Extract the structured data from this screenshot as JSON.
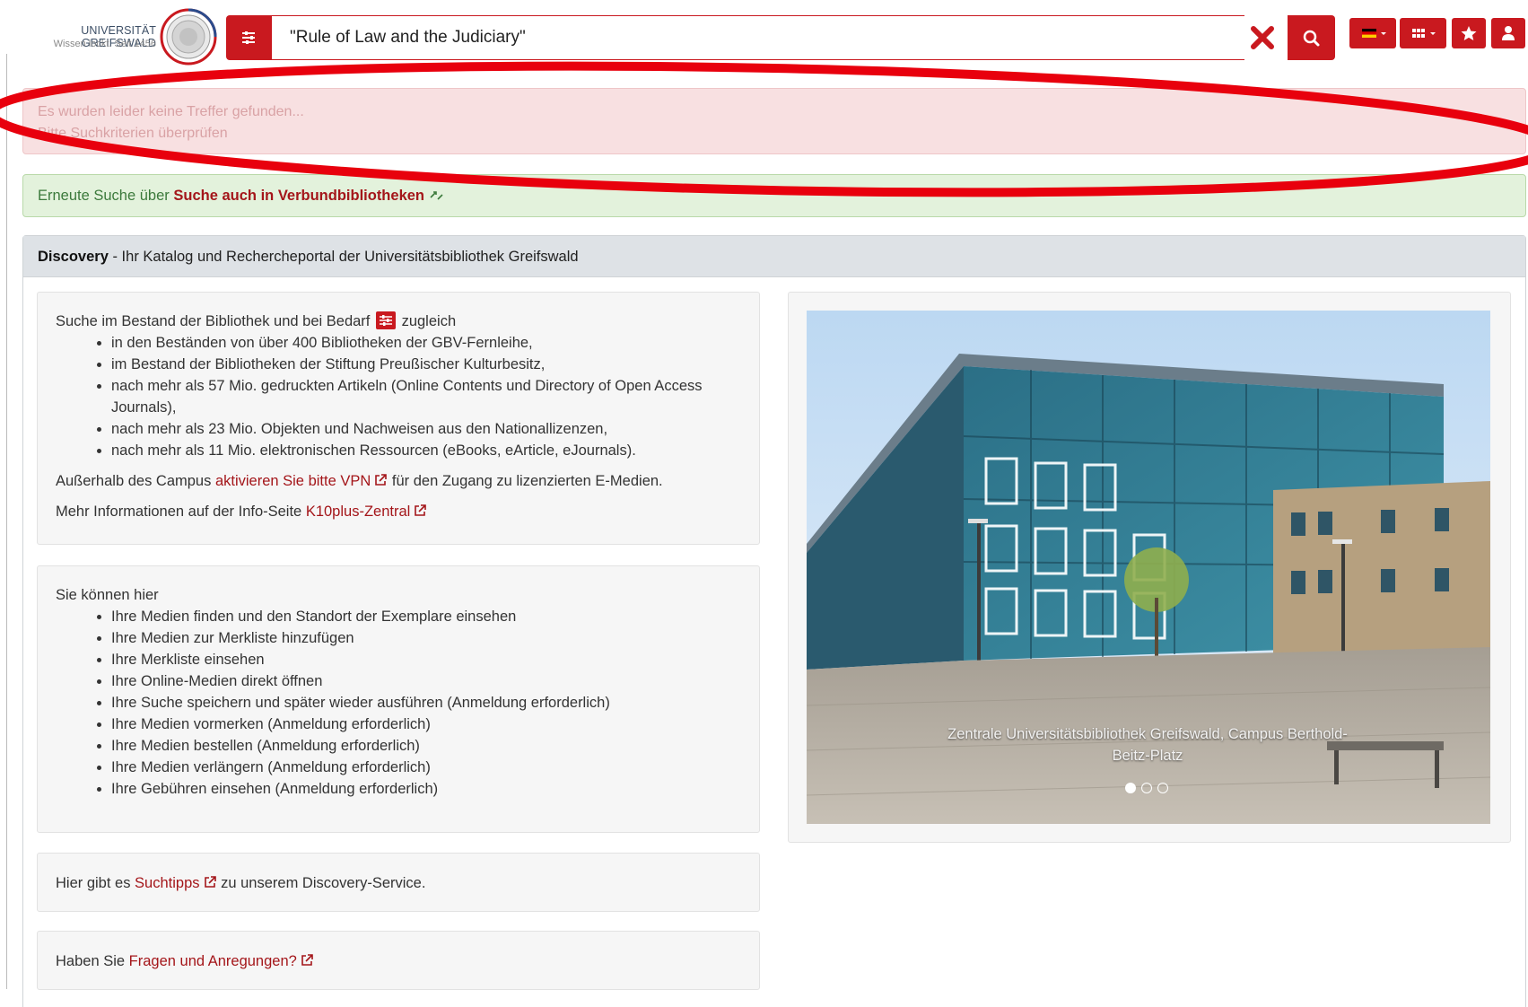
{
  "header": {
    "logo_name": "UNIVERSITÄT GREIFSWALD",
    "logo_tagline": "Wissen lockt. Seit 1456",
    "search_value": "\"Rule of Law and the Judiciary\"",
    "icons": [
      "sliders-icon",
      "clear-x-icon",
      "search-icon",
      "flag-de-icon",
      "grid-icon",
      "star-icon",
      "user-icon"
    ]
  },
  "alerts": {
    "no_results_line1": "Es wurden leider keine Treffer gefunden...",
    "no_results_line2": "Bitte Suchkriterien überprüfen",
    "retry_prefix": "Erneute Suche über",
    "retry_link": "Suche auch in Verbundbibliotheken"
  },
  "panel": {
    "title_bold": "Discovery",
    "title_rest": " - Ihr Katalog und Rechercheportal der Universitätsbibliothek Greifswald",
    "intro": {
      "lead_before": "Suche im Bestand der Bibliothek und bei Bedarf",
      "lead_after": "zugleich",
      "items": [
        "in den Beständen von über 400 Bibliotheken der GBV-Fernleihe,",
        "im Bestand der Bibliotheken der Stiftung Preußischer Kulturbesitz,",
        "nach mehr als 57 Mio. gedruckten Artikeln (Online Contents und Directory of Open Access Journals),",
        "nach mehr als 23 Mio. Objekten und Nachweisen aus den Nationallizenzen,",
        "nach mehr als 11 Mio. elektronischen Ressourcen (eBooks, eArticle, eJournals)."
      ],
      "vpn_before": "Außerhalb des Campus",
      "vpn_link": "aktivieren Sie bitte VPN",
      "vpn_after": "für den Zugang zu lizenzierten E-Medien.",
      "info_before": "Mehr Informationen auf der Info-Seite",
      "info_link": "K10plus-Zentral"
    },
    "features": {
      "lead": "Sie können hier",
      "items": [
        "Ihre Medien finden und den Standort der Exemplare einsehen",
        "Ihre Medien zur Merkliste hinzufügen",
        "Ihre Merkliste einsehen",
        "Ihre Online-Medien direkt öffnen",
        "Ihre Suche speichern und später wieder ausführen (Anmeldung erforderlich)",
        "Ihre Medien vormerken (Anmeldung erforderlich)",
        "Ihre Medien bestellen (Anmeldung erforderlich)",
        "Ihre Medien verlängern (Anmeldung erforderlich)",
        "Ihre Gebühren einsehen (Anmeldung erforderlich)"
      ]
    },
    "tips": {
      "before": "Hier gibt es",
      "link": "Suchtipps",
      "after": "zu unserem Discovery-Service."
    },
    "questions": {
      "before": "Haben Sie",
      "link": "Fragen und Anregungen?"
    },
    "carousel": {
      "caption": "Zentrale Universitätsbibliothek Greifswald, Campus Berthold-Beitz-Platz",
      "slide_count": 3,
      "active_slide": 1
    }
  },
  "colors": {
    "brand": "#c9191f",
    "link": "#a4161a",
    "annotation": "#e8000d"
  }
}
